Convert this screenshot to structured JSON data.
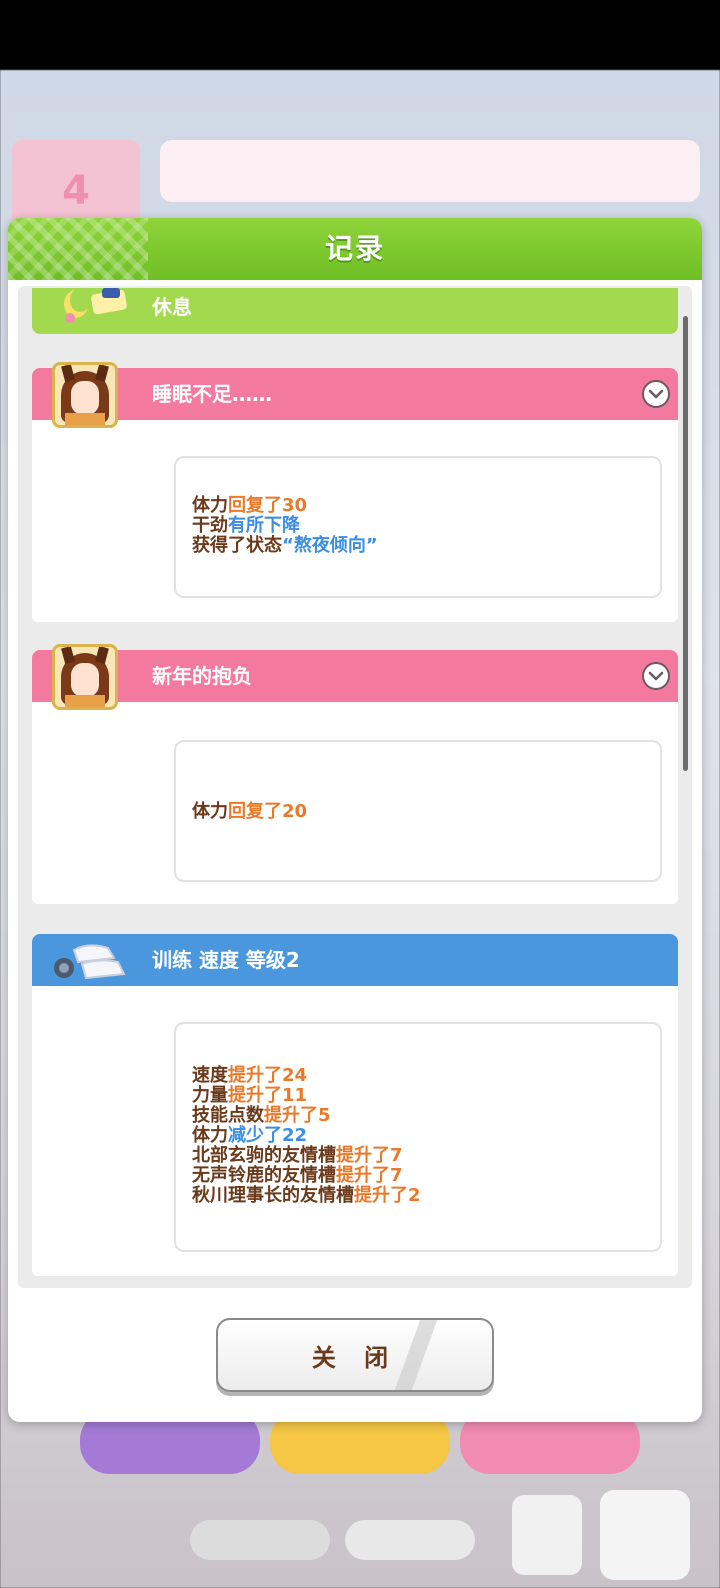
{
  "dialog": {
    "title": "记录",
    "close_label": "关 闭"
  },
  "background": {
    "date_number": "4"
  },
  "entries": [
    {
      "title": "休息",
      "color": "#a3d94e",
      "icon": "rest-icon"
    },
    {
      "title": "睡眠不足……",
      "color": "#f4799e",
      "icon": "character-avatar",
      "lines": [
        [
          {
            "t": "体力",
            "c": "base"
          },
          {
            "t": "回复了30",
            "c": "up"
          }
        ],
        [
          {
            "t": "干劲",
            "c": "base"
          },
          {
            "t": "有所下降",
            "c": "down"
          }
        ],
        [
          {
            "t": "获得了状态",
            "c": "base"
          },
          {
            "t": "“熬夜倾向”",
            "c": "down"
          }
        ]
      ]
    },
    {
      "title": "新年的抱负",
      "color": "#f4799e",
      "icon": "character-avatar",
      "lines": [
        [
          {
            "t": "体力",
            "c": "base"
          },
          {
            "t": "回复了20",
            "c": "up"
          }
        ]
      ]
    },
    {
      "title": "训练 速度 等级2",
      "color": "#4a97de",
      "icon": "shoes-icon",
      "lines": [
        [
          {
            "t": "速度",
            "c": "base"
          },
          {
            "t": "提升了24",
            "c": "up"
          }
        ],
        [
          {
            "t": "力量",
            "c": "base"
          },
          {
            "t": "提升了11",
            "c": "up"
          }
        ],
        [
          {
            "t": "技能点数",
            "c": "base"
          },
          {
            "t": "提升了5",
            "c": "up"
          }
        ],
        [
          {
            "t": "体力",
            "c": "base"
          },
          {
            "t": "减少了22",
            "c": "down"
          }
        ],
        [
          {
            "t": "北部玄驹的友情槽",
            "c": "base"
          },
          {
            "t": "提升了7",
            "c": "up"
          }
        ],
        [
          {
            "t": "无声铃鹿的友情槽",
            "c": "base"
          },
          {
            "t": "提升了7",
            "c": "up"
          }
        ],
        [
          {
            "t": "秋川理事长的友情槽",
            "c": "base"
          },
          {
            "t": "提升了2",
            "c": "up"
          }
        ]
      ]
    }
  ]
}
